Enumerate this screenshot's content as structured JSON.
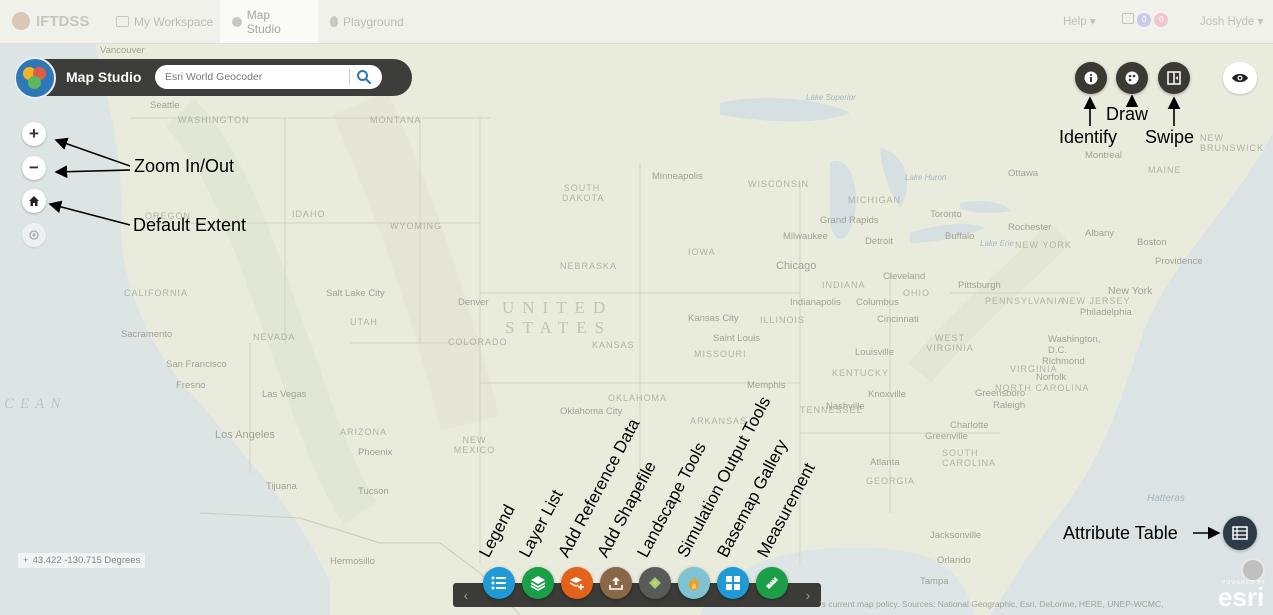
{
  "topnav": {
    "brand": "IFTDSS",
    "tabs": [
      {
        "label": "My Workspace"
      },
      {
        "label": "Map Studio"
      },
      {
        "label": "Playground"
      }
    ],
    "help": "Help ▾",
    "notifications": {
      "a": "0",
      "b": "0"
    },
    "user": "Josh Hyde ▾"
  },
  "studio": {
    "title": "Map Studio",
    "search_placeholder": "Esri World Geocoder"
  },
  "map_labels": {
    "states": [
      "WASHINGTON",
      "MONTANA",
      "SOUTH DAKOTA",
      "WISCONSIN",
      "MICHIGAN",
      "OREGON",
      "IDAHO",
      "WYOMING",
      "NEBRASKA",
      "IOWA",
      "CALIFORNIA",
      "NEVADA",
      "UTAH",
      "COLORADO",
      "KANSAS",
      "ILLINOIS",
      "INDIANA",
      "OHIO",
      "MISSOURI",
      "KENTUCKY",
      "ARIZONA",
      "NEW MEXICO",
      "OKLAHOMA",
      "ARKANSAS",
      "TENNESSEE",
      "GEORGIA",
      "SOUTH CAROLINA",
      "NORTH CAROLINA",
      "VIRGINIA",
      "WEST VIRGINIA",
      "PENNSYLVANIA",
      "NEW YORK",
      "NEW JERSEY",
      "MAINE",
      "NEW BRUNSWICK"
    ],
    "cities": [
      "Vancouver",
      "Seattle",
      "Minneapolis",
      "Milwaukee",
      "Grand Rapids",
      "Detroit",
      "Toronto",
      "Rochester",
      "Albany",
      "Boston",
      "Providence",
      "Chicago",
      "Cleveland",
      "Pittsburgh",
      "Buffalo",
      "Indianapolis",
      "Columbus",
      "Cincinnati",
      "New York",
      "Philadelphia",
      "Washington, D.C.",
      "Richmond",
      "Norfolk",
      "Denver",
      "Salt Lake City",
      "Sacramento",
      "San Francisco",
      "Fresno",
      "Las Vegas",
      "Los Angeles",
      "Phoenix",
      "Tucson",
      "Tijuana",
      "Hermosillo",
      "Kansas City",
      "Saint Louis",
      "Louisville",
      "Knoxville",
      "Nashville",
      "Charlotte",
      "Greensboro",
      "Raleigh",
      "Greenville",
      "Atlanta",
      "Oklahoma City",
      "Jacksonville",
      "Orlando",
      "Tampa",
      "Montreal",
      "Ottawa",
      "Memphis"
    ],
    "big": [
      "UNITED",
      "STATES"
    ],
    "ocean": "CEAN",
    "water": [
      "Lake Superior",
      "Lake Huron",
      "Lake Erie",
      "Hatteras"
    ]
  },
  "coords": "43.422 -130.715 Degrees",
  "attribution": "'s current map policy. Sources: National Geographic, Esri, DeLorme, HERE, UNEP-WCMC,",
  "esri": "esri",
  "esri_small": "POWERED BY",
  "annotations": {
    "zoom": "Zoom In/Out",
    "default_extent": "Default Extent",
    "identify": "Identify",
    "draw": "Draw",
    "swipe": "Swipe",
    "attribute_table": "Attribute Table",
    "legend": "Legend",
    "layer_list": "Layer List",
    "add_reference": "Add Reference Data",
    "add_shapefile": "Add Shapefile",
    "landscape": "Landscape Tools",
    "sim_output": "Simulation Output Tools",
    "basemap": "Basemap Gallery",
    "measurement": "Measurement"
  },
  "toolbar_colors": {
    "legend": "#1e9bd7",
    "layer_list": "#1a9e47",
    "add_reference": "#e2621b",
    "add_shapefile": "#8a6748",
    "landscape": "#5a5a58",
    "sim_output": "#7fc3d3",
    "basemap": "#1e9bd7",
    "measurement": "#1a9e47"
  },
  "icons": {
    "zoom_in": "+",
    "zoom_out": "−",
    "prev": "‹",
    "next": "›"
  }
}
